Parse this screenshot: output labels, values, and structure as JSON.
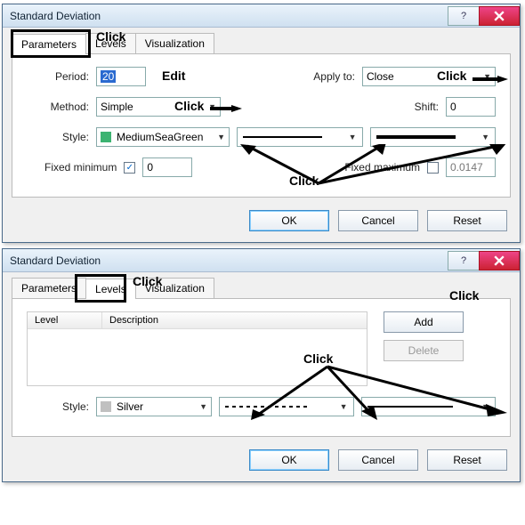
{
  "dialog1": {
    "title": "Standard Deviation",
    "tabs": {
      "parameters": "Parameters",
      "levels": "Levels",
      "visualization": "Visualization"
    },
    "period_label": "Period:",
    "period_value": "20",
    "apply_label": "Apply to:",
    "apply_value": "Close",
    "method_label": "Method:",
    "method_value": "Simple",
    "shift_label": "Shift:",
    "shift_value": "0",
    "style_label": "Style:",
    "color_name": "MediumSeaGreen",
    "color_hex": "#3cb371",
    "fixed_min_label": "Fixed minimum",
    "fixed_min_checked": true,
    "fixed_min_value": "0",
    "fixed_max_label": "Fixed maximum",
    "fixed_max_checked": false,
    "fixed_max_value": "0.0147",
    "buttons": {
      "ok": "OK",
      "cancel": "Cancel",
      "reset": "Reset"
    }
  },
  "dialog2": {
    "title": "Standard Deviation",
    "tabs": {
      "parameters": "Parameters",
      "levels": "Levels",
      "visualization": "Visualization"
    },
    "table": {
      "level_head": "Level",
      "desc_head": "Description"
    },
    "add": "Add",
    "delete": "Delete",
    "style_label": "Style:",
    "color_name": "Silver",
    "color_hex": "#c0c0c0",
    "buttons": {
      "ok": "OK",
      "cancel": "Cancel",
      "reset": "Reset"
    }
  },
  "hints": {
    "click": "Click",
    "edit": "Edit"
  }
}
